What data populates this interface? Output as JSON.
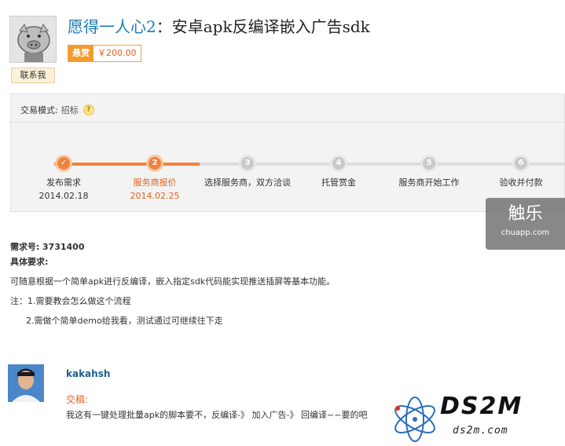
{
  "header": {
    "username": "愿得一人心2",
    "separator": "：",
    "title": "安卓apk反编译嵌入广告sdk",
    "contact_label": "联系我",
    "reward_tag": "悬赏",
    "reward_amount": "￥200.00"
  },
  "panel": {
    "mode_label": "交易模式:",
    "mode_value": "招标",
    "help_icon_text": "?",
    "steps": [
      {
        "num": "✓",
        "label": "发布需求",
        "date": "2014.02.18"
      },
      {
        "num": "2",
        "label": "服务商报价",
        "date": "2014.02.25"
      },
      {
        "num": "3",
        "label": "选择服务商，双方洽谈",
        "date": ""
      },
      {
        "num": "4",
        "label": "托管赏金",
        "date": ""
      },
      {
        "num": "5",
        "label": "服务商开始工作",
        "date": ""
      },
      {
        "num": "6",
        "label": "验收并付款",
        "date": ""
      }
    ]
  },
  "watermark_chuapp": {
    "big": "触乐",
    "small": "chuapp.com"
  },
  "requirement": {
    "id_label": "需求号:",
    "id_value": "3731400",
    "detail_label": "具体要求:",
    "line1": "可随意根据一个简单apk进行反编译，嵌入指定sdk代码能实现推送插屏等基本功能。",
    "note1": "注：1.需要教会怎么做这个流程",
    "note2": "2.需做个简单demo给我看，测试通过可继续往下走"
  },
  "reply": {
    "username": "kakahsh",
    "tag": "交稿:",
    "text": "我这有一键处理批量apk的脚本要不，反编译-》 加入广告-》 回编译~~要的吧"
  },
  "watermark_ds2m": {
    "logo": "DS2M",
    "site": "ds2m.com"
  },
  "colors": {
    "accent": "#f0823c",
    "link": "#1a7bb6",
    "active_text": "#e8611c"
  }
}
